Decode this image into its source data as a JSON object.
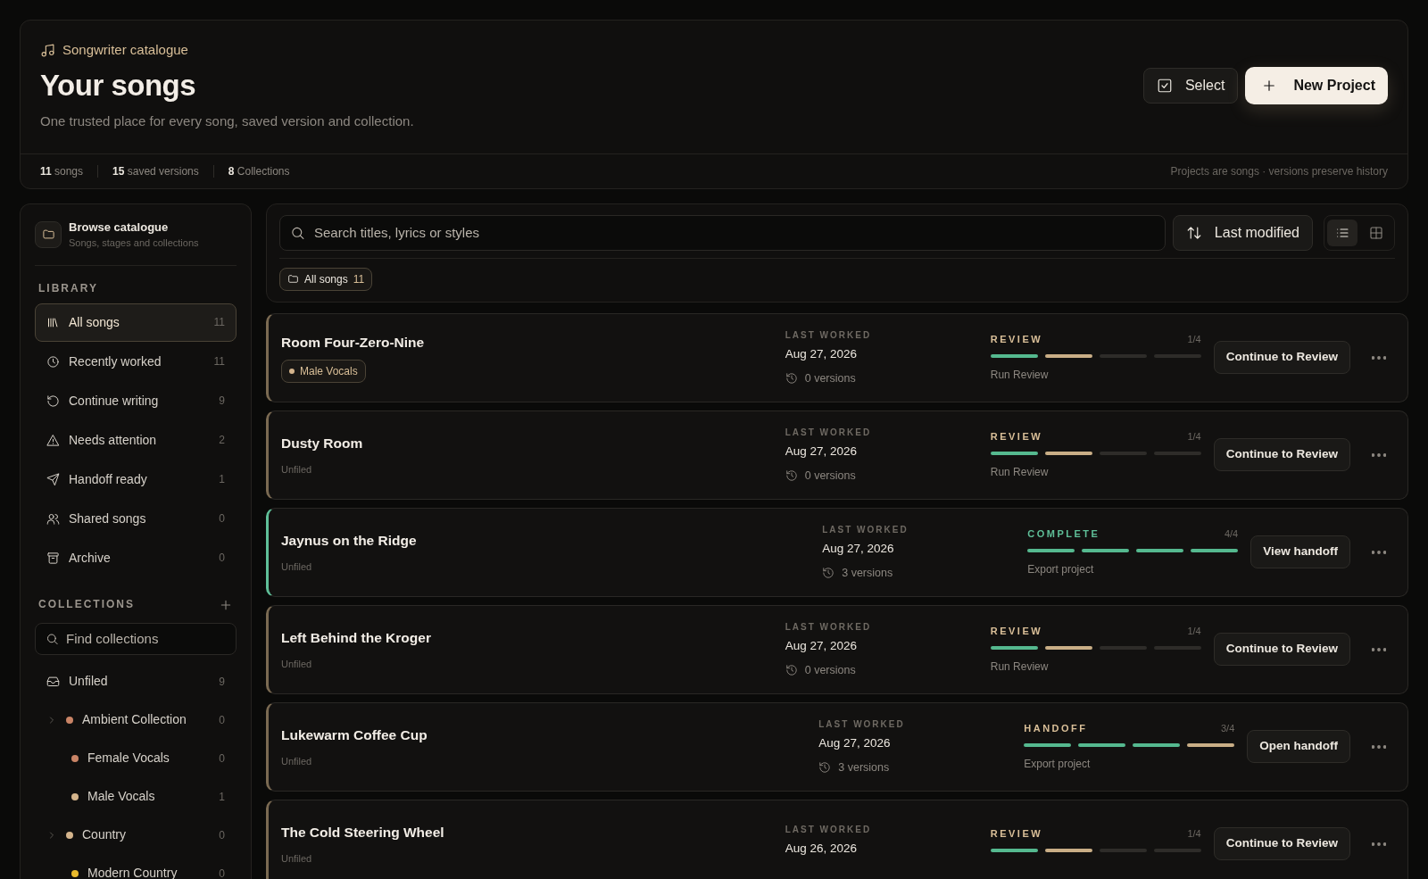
{
  "header": {
    "eyebrow": "Songwriter catalogue",
    "title": "Your songs",
    "subtitle": "One trusted place for every song, saved version and collection.",
    "actions": [
      {
        "label": "Select",
        "kind": "secondary"
      },
      {
        "label": "New Project",
        "kind": "primary"
      }
    ],
    "stats": [
      "**11** songs",
      "**15** saved versions",
      "**8** Collections"
    ],
    "note": "Projects are songs · versions preserve history"
  },
  "sidebar": {
    "title": "Browse catalogue",
    "subtitle": "Songs, stages and collections",
    "library_heading": "LIBRARY",
    "library": [
      {
        "label": "All songs",
        "count": "11",
        "selected": true
      },
      {
        "label": "Recently worked",
        "count": "11",
        "selected": false
      },
      {
        "label": "Continue writing",
        "count": "9",
        "selected": false
      },
      {
        "label": "Needs attention",
        "count": "2",
        "selected": false
      },
      {
        "label": "Handoff ready",
        "count": "1",
        "selected": false
      },
      {
        "label": "Shared songs",
        "count": "0",
        "selected": false
      },
      {
        "label": "Archive",
        "count": "0",
        "selected": false
      }
    ],
    "collections_heading": "COLLECTIONS",
    "collections_search": {
      "placeholder": "Find collections"
    },
    "collections": [
      {
        "label": "Unfiled",
        "count": "9",
        "kind": "inbox"
      },
      {
        "label": "Ambient Collection",
        "count": "0",
        "kind": "folder",
        "color": "#c98466",
        "children": [
          {
            "label": "Female Vocals",
            "count": "0",
            "color": "#c98466"
          },
          {
            "label": "Male Vocals",
            "count": "1",
            "color": "#d4b48c"
          }
        ]
      },
      {
        "label": "Country",
        "count": "0",
        "kind": "folder",
        "color": "#d4b48c",
        "children": [
          {
            "label": "Modern Country",
            "count": "0",
            "color": "#e8b92c"
          }
        ]
      }
    ]
  },
  "toolbar": {
    "search": {
      "placeholder": "Search titles, lyrics or styles"
    },
    "sort": "Last modified",
    "views": [
      {
        "selected": true
      },
      {
        "selected": false
      }
    ],
    "filter": {
      "label": "All songs",
      "count": "11"
    }
  },
  "songs": [
    {
      "title": "Room Four-Zero-Nine",
      "tag": {
        "label": "Male Vocals",
        "color": "#d4b48c"
      },
      "last_label": "LAST WORKED",
      "date": "Aug 27, 2026",
      "versions": "0 versions",
      "kind": "review",
      "stage": "REVIEW",
      "progress": "1/4",
      "steps": [
        {
          "done": true
        },
        {
          "done": false
        },
        {
          "done": false
        },
        {
          "done": false
        }
      ],
      "next": "Run Review",
      "action": "Continue to Review"
    },
    {
      "title": "Dusty Room",
      "collection": "Unfiled",
      "last_label": "LAST WORKED",
      "date": "Aug 27, 2026",
      "versions": "0 versions",
      "kind": "review",
      "stage": "REVIEW",
      "progress": "1/4",
      "steps": [
        {
          "done": true
        },
        {
          "done": false
        },
        {
          "done": false
        },
        {
          "done": false
        }
      ],
      "next": "Run Review",
      "action": "Continue to Review"
    },
    {
      "title": "Jaynus on the Ridge",
      "collection": "Unfiled",
      "last_label": "LAST WORKED",
      "date": "Aug 27, 2026",
      "versions": "3 versions",
      "kind": "complete",
      "stage": "COMPLETE",
      "progress": "4/4",
      "steps": [
        {
          "done": true
        },
        {
          "done": true
        },
        {
          "done": true
        },
        {
          "done": true
        }
      ],
      "next": "Export project",
      "action": "View handoff"
    },
    {
      "title": "Left Behind the Kroger",
      "collection": "Unfiled",
      "last_label": "LAST WORKED",
      "date": "Aug 27, 2026",
      "versions": "0 versions",
      "kind": "review",
      "stage": "REVIEW",
      "progress": "1/4",
      "steps": [
        {
          "done": true
        },
        {
          "done": false
        },
        {
          "done": false
        },
        {
          "done": false
        }
      ],
      "next": "Run Review",
      "action": "Continue to Review"
    },
    {
      "title": "Lukewarm Coffee Cup",
      "collection": "Unfiled",
      "last_label": "LAST WORKED",
      "date": "Aug 27, 2026",
      "versions": "3 versions",
      "kind": "handoff",
      "stage": "HANDOFF",
      "progress": "3/4",
      "steps": [
        {
          "done": true
        },
        {
          "done": true
        },
        {
          "done": true
        },
        {
          "done": false
        }
      ],
      "next": "Export project",
      "action": "Open handoff"
    },
    {
      "title": "The Cold Steering Wheel",
      "collection": "Unfiled",
      "last_label": "LAST WORKED",
      "date": "Aug 26, 2026",
      "kind": "review",
      "stage": "REVIEW",
      "progress": "1/4",
      "steps": [
        {
          "done": true
        },
        {
          "done": false
        },
        {
          "done": false
        },
        {
          "done": false
        }
      ],
      "action": "Continue to Review"
    }
  ]
}
